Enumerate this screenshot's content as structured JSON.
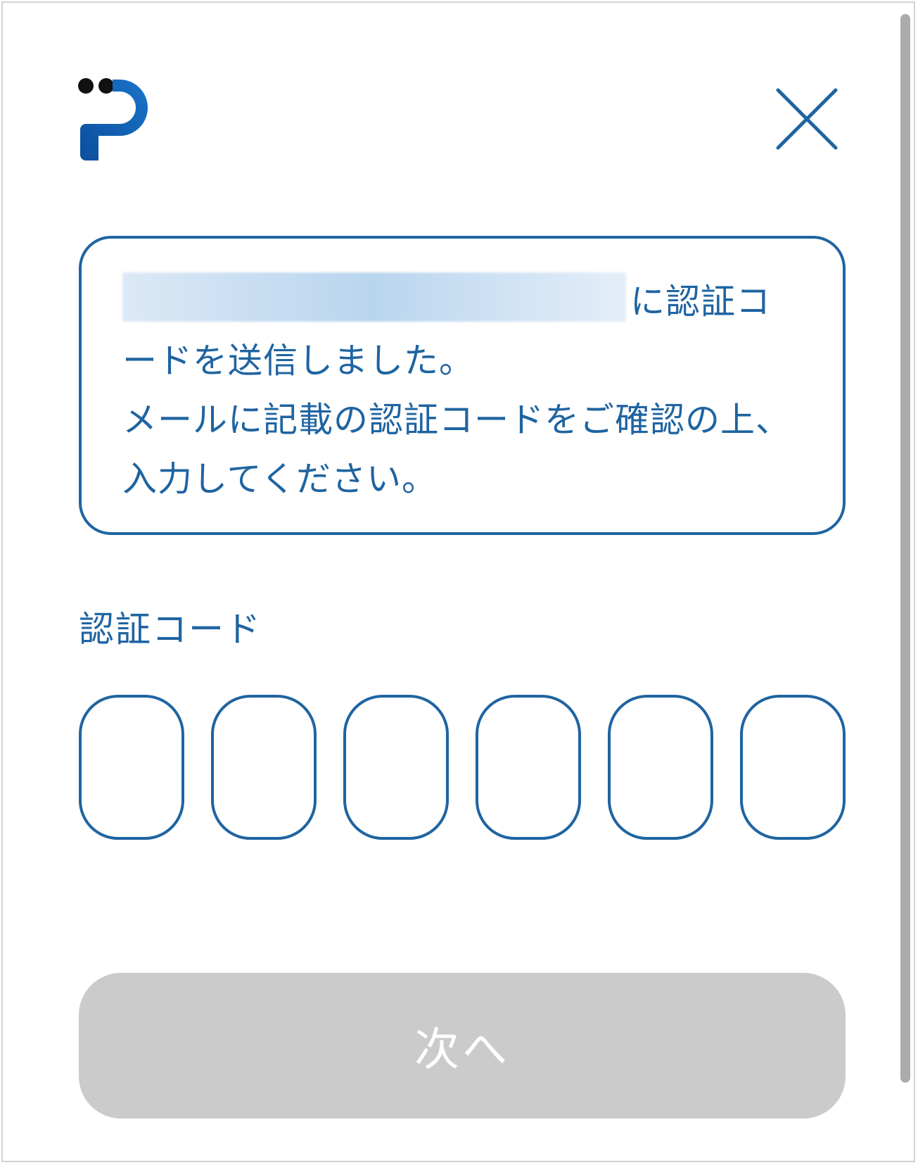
{
  "header": {
    "logo_icon": "brand-p-logo-icon",
    "close_icon": "close-icon"
  },
  "message": {
    "email_redacted": true,
    "text_line1_suffix": "に認証コ",
    "text_rest": "ードを送信しました。\nメールに記載の認証コードをご確認の上、入力してください。"
  },
  "code": {
    "label": "認証コード",
    "digits": [
      "",
      "",
      "",
      "",
      "",
      ""
    ]
  },
  "actions": {
    "next_label": "次へ",
    "next_enabled": false
  },
  "colors": {
    "primary": "#1f64a1",
    "disabled_button": "#cbcbcb",
    "border": "#d2d2d2",
    "scrollbar": "#ababab"
  }
}
